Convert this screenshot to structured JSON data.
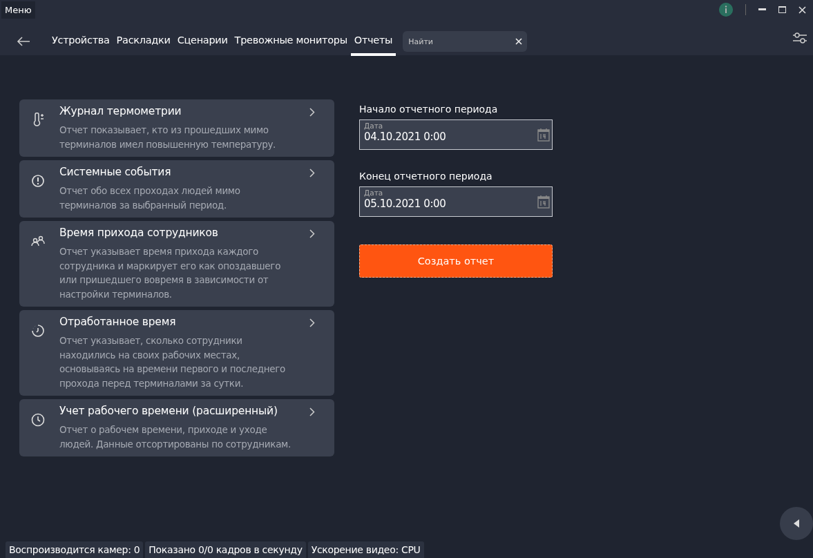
{
  "menu_label": "Меню",
  "nav": {
    "tabs": [
      {
        "label": "Устройства",
        "selected": false
      },
      {
        "label": "Раскладки",
        "selected": false
      },
      {
        "label": "Сценарии",
        "selected": false
      },
      {
        "label": "Тревожные мониторы",
        "selected": false
      },
      {
        "label": "Отчеты",
        "selected": true
      }
    ],
    "search": {
      "placeholder": "Найти"
    }
  },
  "reports": [
    {
      "title": "Журнал термометрии",
      "description": "Отчет показывает, кто из прошедших мимо терминалов имел повышенную температуру."
    },
    {
      "title": "Системные события",
      "description": "Отчет обо всех проходах людей мимо терминалов за выбранный период."
    },
    {
      "title": "Время прихода сотрудников",
      "description": "Отчет указывает время прихода каждого сотрудника и маркирует его как опоздавшего или пришедшего вовремя в зависимости от настройки терминалов."
    },
    {
      "title": "Отработанное время",
      "description": "Отчет указывает, сколько сотрудники находились на своих рабочих местах, основываясь на времени первого и последнего прохода перед терминалами за сутки."
    },
    {
      "title": "Учет рабочего времени (расширенный)",
      "description": "Отчет о рабочем времени, приходе и уходе людей. Данные отсортированы по сотрудникам."
    }
  ],
  "period": [
    {
      "heading": "Начало отчетного периода",
      "field_label": "Дата",
      "value": "04.10.2021 0:00"
    },
    {
      "heading": "Конец отчетного периода",
      "field_label": "Дата",
      "value": "05.10.2021 0:00"
    }
  ],
  "create_button": "Создать отчет",
  "status_bar": [
    "Воспроизводится камер: 0",
    "Показано 0/0 кадров в секунду",
    "Ускорение видео: CPU"
  ]
}
